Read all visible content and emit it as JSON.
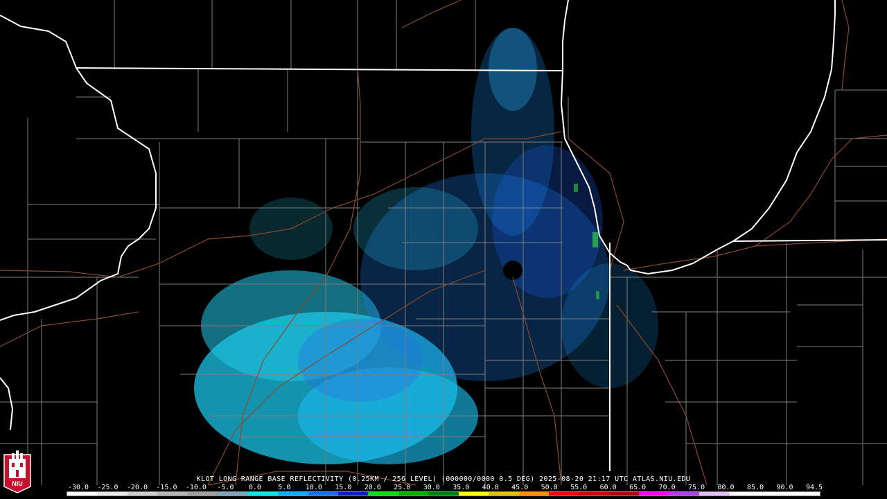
{
  "product": {
    "caption": "KLOT LONG RANGE BASE REFLECTIVITY (0.25KM / 256 LEVEL) (000000/0000 0.5 DEG) 2025-08-20 21:17 UTC  ATLAS.NIU.EDU"
  },
  "logo": {
    "text": "NIU",
    "color": "#c8102e"
  },
  "colors": {
    "background": "#000000",
    "state_lines": "#ffffff",
    "county_lines": "#808080",
    "roads": "#8b4a2b"
  },
  "colorbar": {
    "ticks": [
      "-30.0",
      "-25.0",
      "-20.0",
      "-15.0",
      "-10.0",
      "-5.0",
      "0.0",
      "5.0",
      "10.0",
      "15.0",
      "20.0",
      "25.0",
      "30.0",
      "35.0",
      "40.0",
      "45.0",
      "50.0",
      "55.0",
      "60.0",
      "65.0",
      "70.0",
      "75.0",
      "80.0",
      "85.0",
      "90.0",
      "94.5"
    ],
    "colors": [
      "#ffffff",
      "#e8e8e8",
      "#cfcfcf",
      "#b8b8b8",
      "#a0a0a0",
      "#7fa6c0",
      "#00e5ee",
      "#00b0f0",
      "#1a6cf0",
      "#0a20c8",
      "#00e000",
      "#00b000",
      "#008000",
      "#ffff00",
      "#e8c000",
      "#ff9000",
      "#ff0000",
      "#d00000",
      "#b00000",
      "#ff00ff",
      "#b040e0",
      "#e0c0ff",
      "#ffffff",
      "#ffffff",
      "#ffffff"
    ]
  }
}
